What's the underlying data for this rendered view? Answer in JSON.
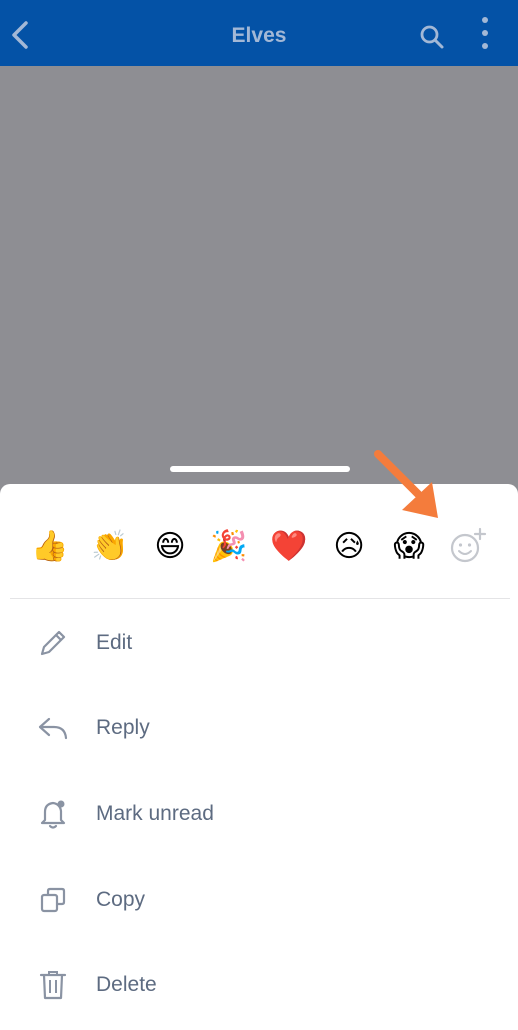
{
  "header": {
    "title": "Elves",
    "background_color": "#0452a6",
    "icons": [
      "chevron-left-icon",
      "search-icon",
      "more-vertical-icon"
    ]
  },
  "reactions": [
    {
      "name": "thumbs-up",
      "glyph": "👍"
    },
    {
      "name": "clapping-hands",
      "glyph": "👏"
    },
    {
      "name": "grinning-face",
      "glyph": "😄"
    },
    {
      "name": "party-popper",
      "glyph": "🎉"
    },
    {
      "name": "red-heart",
      "glyph": "❤️"
    },
    {
      "name": "sad-relieved-face",
      "glyph": "😥"
    },
    {
      "name": "screaming-face",
      "glyph": "😱"
    }
  ],
  "add_reaction_icon": "smiley-plus-icon",
  "annotation": {
    "icon": "arrow-icon",
    "color": "#f47c3c"
  },
  "menu": [
    {
      "label": "Edit",
      "icon": "pencil-icon"
    },
    {
      "label": "Reply",
      "icon": "reply-icon"
    },
    {
      "label": "Mark unread",
      "icon": "bell-dot-icon"
    },
    {
      "label": "Copy",
      "icon": "copy-icon"
    },
    {
      "label": "Delete",
      "icon": "trash-icon"
    }
  ],
  "colors": {
    "overlay": "#8e8e93",
    "menu_text": "#5d6b81",
    "menu_icon": "#8a93a3"
  }
}
